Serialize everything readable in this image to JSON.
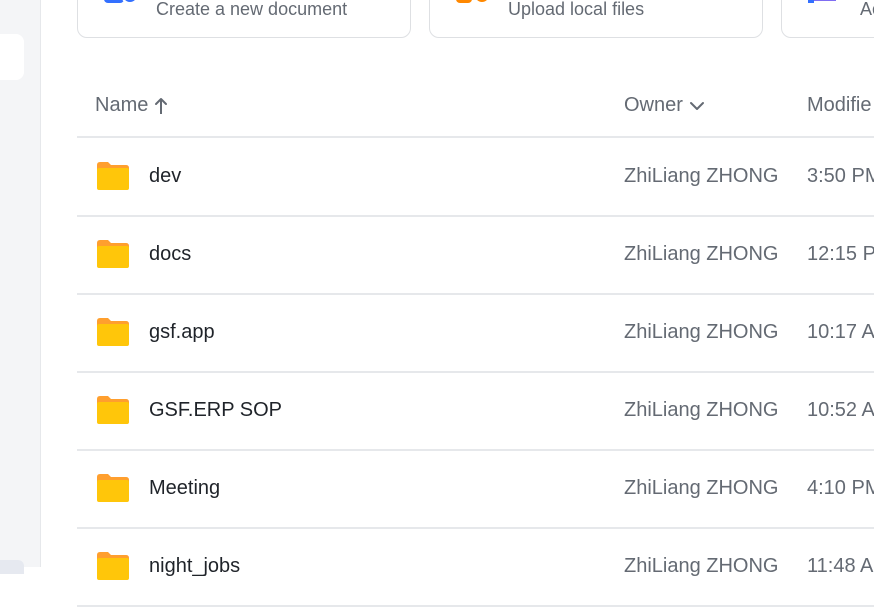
{
  "actions": [
    {
      "label": "Create a new document",
      "icon": "new-document-icon"
    },
    {
      "label": "Upload local files",
      "icon": "upload-icon"
    },
    {
      "label": "Ac",
      "icon": "add-icon"
    }
  ],
  "table": {
    "columns": {
      "name": "Name",
      "owner": "Owner",
      "modified": "Modifie"
    },
    "rows": [
      {
        "name": "dev",
        "owner": "ZhiLiang ZHONG",
        "modified": "3:50 PM"
      },
      {
        "name": "docs",
        "owner": "ZhiLiang ZHONG",
        "modified": "12:15 P"
      },
      {
        "name": "gsf.app",
        "owner": "ZhiLiang ZHONG",
        "modified": "10:17 A"
      },
      {
        "name": "GSF.ERP SOP",
        "owner": "ZhiLiang ZHONG",
        "modified": "10:52 A"
      },
      {
        "name": "Meeting",
        "owner": "ZhiLiang ZHONG",
        "modified": "4:10 PM"
      },
      {
        "name": "night_jobs",
        "owner": "ZhiLiang ZHONG",
        "modified": "11:48 A"
      }
    ]
  },
  "colors": {
    "folder": "#ffc60a",
    "folder_tab": "#ff9f2e",
    "accent_blue": "#3370ff",
    "accent_orange": "#ff8800",
    "accent_purple": "#7f6df2"
  }
}
